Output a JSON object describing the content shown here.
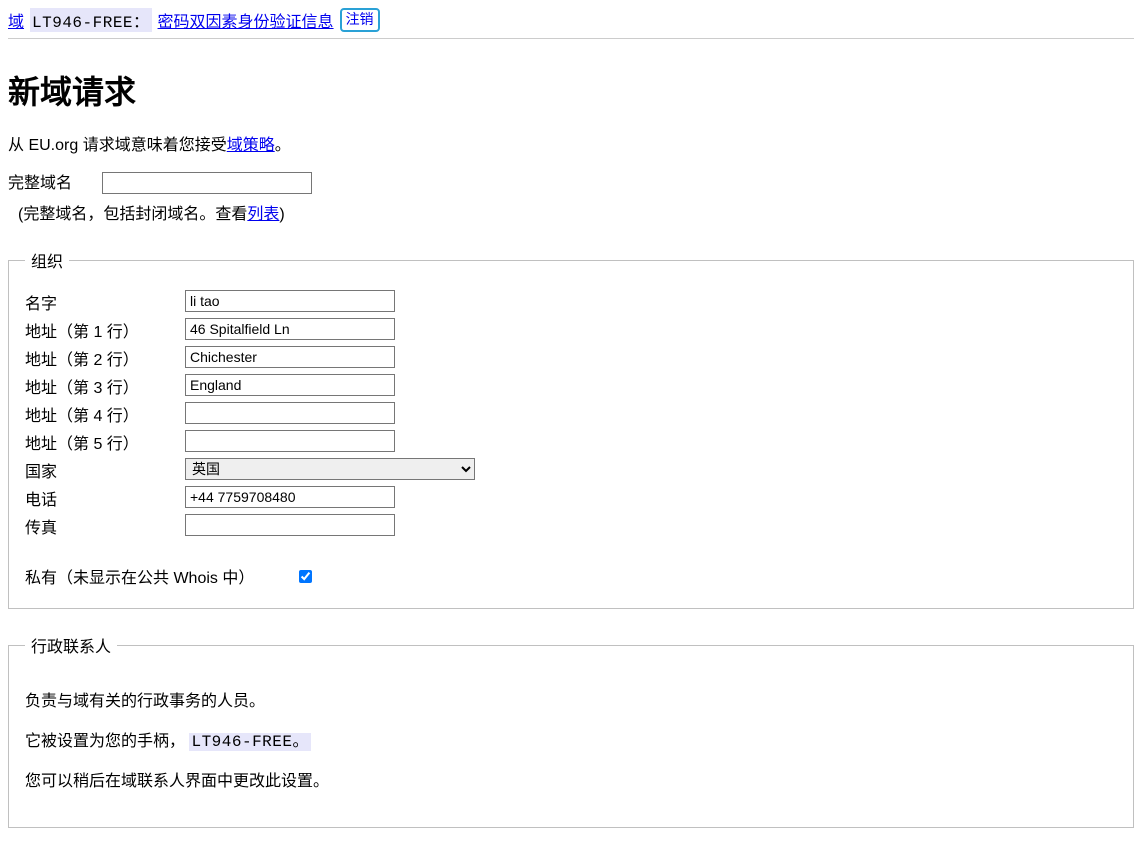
{
  "topbar": {
    "domains_link": "域",
    "handle": "LT946-FREE：",
    "password_2fa_link": "密码双因素身份验证信息",
    "logout": "注销"
  },
  "page": {
    "title": "新域请求",
    "policy_prefix": "从 EU.org 请求域意味着您接受",
    "policy_link": "域策略",
    "policy_suffix": "。"
  },
  "domain": {
    "label": "完整域名",
    "value": "",
    "hint_prefix": "(完整域名，包括封闭域名。查看",
    "hint_link": "列表",
    "hint_suffix": ")"
  },
  "org": {
    "legend": "组织",
    "labels": {
      "name": "名字",
      "addr1": "地址（第 1 行）",
      "addr2": "地址（第 2 行）",
      "addr3": "地址（第 3 行）",
      "addr4": "地址（第 4 行）",
      "addr5": "地址（第 5 行）",
      "country": "国家",
      "phone": "电话",
      "fax": "传真"
    },
    "values": {
      "name": "li tao",
      "addr1": "46 Spitalfield Ln",
      "addr2": "Chichester",
      "addr3": "England",
      "addr4": "",
      "addr5": "",
      "country": "英国",
      "phone": "+44 7759708480",
      "fax": ""
    },
    "private_label": "私有（未显示在公共 Whois 中）",
    "private_checked": true
  },
  "admin": {
    "legend": "行政联系人",
    "p1": "负责与域有关的行政事务的人员。",
    "p2_prefix": "它被设置为您的手柄，",
    "p2_handle": "LT946-FREE。",
    "p3": "您可以稍后在域联系人界面中更改此设置。"
  }
}
